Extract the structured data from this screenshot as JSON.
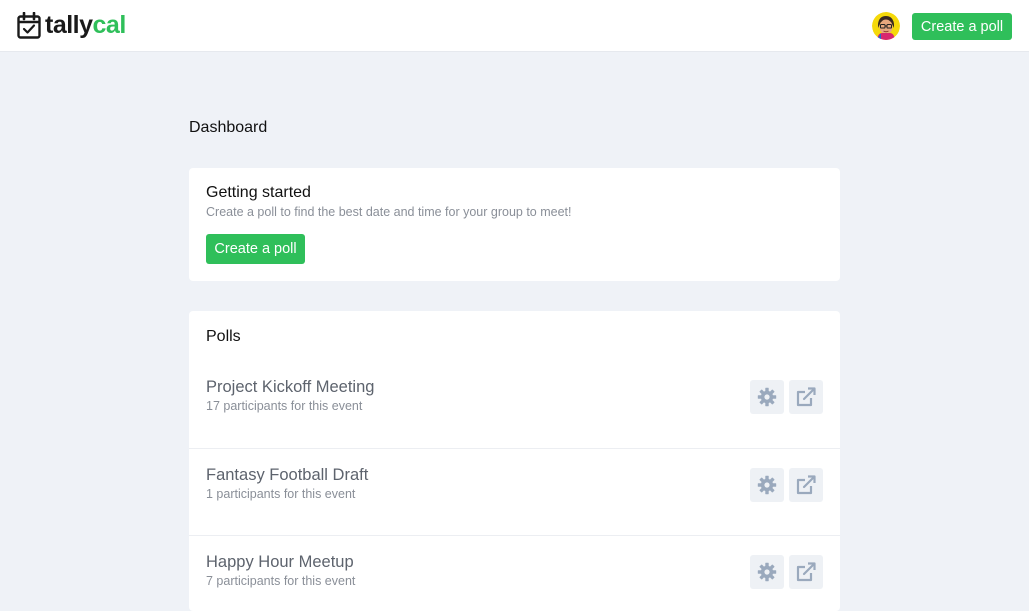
{
  "header": {
    "logo_part1": "tally",
    "logo_part2": "cal",
    "logo_icon": "calendar-check-icon",
    "avatar_icon": "user-avatar",
    "create_poll_label": "Create a poll"
  },
  "main": {
    "page_title": "Dashboard",
    "getting_started": {
      "title": "Getting started",
      "description": "Create a poll to find the best date and time for your group to meet!",
      "button_label": "Create a poll"
    },
    "polls": {
      "title": "Polls",
      "items": [
        {
          "name": "Project Kickoff Meeting",
          "participants": "17 participants for this event"
        },
        {
          "name": "Fantasy Football Draft",
          "participants": "1 participants for this event"
        },
        {
          "name": "Happy Hour Meetup",
          "participants": "7 participants for this event"
        }
      ],
      "row_icons": [
        "gear-icon",
        "external-link-icon"
      ]
    }
  },
  "colors": {
    "brand_green": "#2fbf5a",
    "background": "#eff2f7",
    "card": "#ffffff",
    "icon_button_bg": "#eef1f5",
    "icon_color": "#9aa9bd"
  }
}
